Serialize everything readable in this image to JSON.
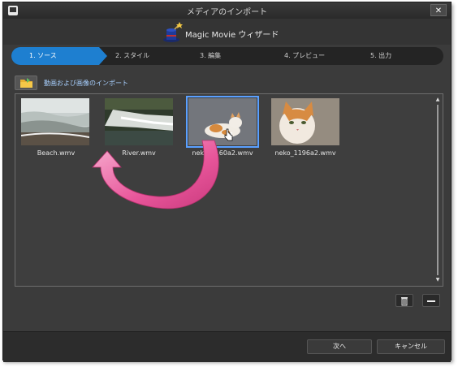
{
  "window": {
    "title": "メディアのインポート",
    "close_label": "✕"
  },
  "header": {
    "title": "Magic Movie ウィザード"
  },
  "steps": [
    {
      "label": "1. ソース",
      "active": true
    },
    {
      "label": "2. スタイル",
      "active": false
    },
    {
      "label": "3. 編集",
      "active": false
    },
    {
      "label": "4. プレビュー",
      "active": false
    },
    {
      "label": "5. 出力",
      "active": false
    }
  ],
  "import": {
    "label": "動画および画像のインポート"
  },
  "media": [
    {
      "name": "Beach.wmv",
      "icon": "beach-thumbnail"
    },
    {
      "name": "River.wmv",
      "icon": "river-thumbnail"
    },
    {
      "name": "neko_1160a2.wmv",
      "icon": "cat-thumbnail",
      "selected": true
    },
    {
      "name": "neko_1196a2.wmv",
      "icon": "cat-closeup-thumbnail"
    }
  ],
  "footer": {
    "next_label": "次へ",
    "cancel_label": "キャンセル"
  },
  "colors": {
    "accent": "#1e7fd0",
    "arrow": "#e8559a",
    "background": "#3b3b3b"
  }
}
